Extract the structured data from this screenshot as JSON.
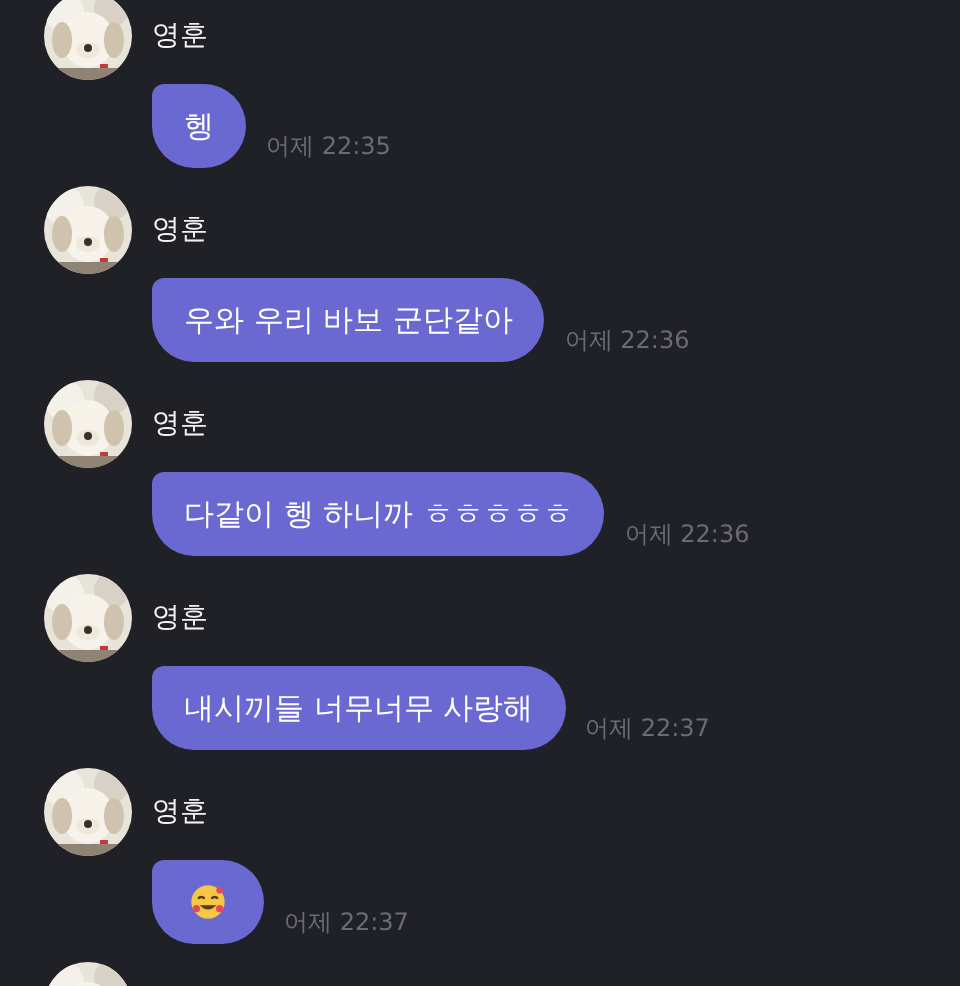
{
  "messages": [
    {
      "sender": "영훈",
      "kind": "text",
      "text": "헹",
      "time": "어제 22:35"
    },
    {
      "sender": "영훈",
      "kind": "text",
      "text": "우와 우리 바보 군단같아",
      "time": "어제 22:36"
    },
    {
      "sender": "영훈",
      "kind": "text",
      "text": "다같이 헹 하니까 ㅎㅎㅎㅎㅎ",
      "time": "어제 22:36"
    },
    {
      "sender": "영훈",
      "kind": "text",
      "text": "내시끼들 너무너무 사랑해",
      "time": "어제 22:37"
    },
    {
      "sender": "영훈",
      "kind": "emoji",
      "time": "어제 22:37"
    },
    {
      "kind": "avatar_only"
    }
  ]
}
